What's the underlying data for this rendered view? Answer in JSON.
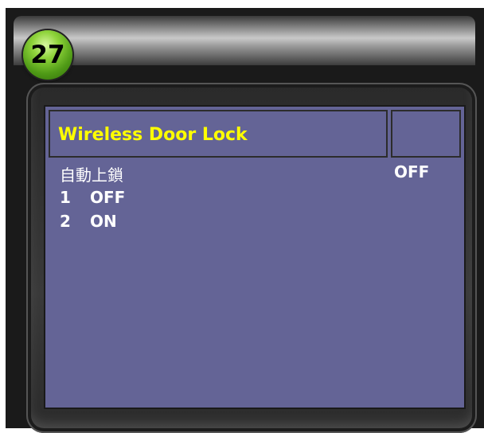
{
  "badge": {
    "number": "27"
  },
  "header": {
    "title": "Wireless Door Lock"
  },
  "setting": {
    "label": "自動上鎖",
    "current_value": "OFF"
  },
  "options": [
    {
      "number": "1",
      "label": "OFF"
    },
    {
      "number": "2",
      "label": "ON"
    }
  ],
  "colors": {
    "screen_bg": "#646496",
    "title_text": "#ffff00",
    "body_text": "#ffffff",
    "badge_green": "#6cbf2a"
  }
}
